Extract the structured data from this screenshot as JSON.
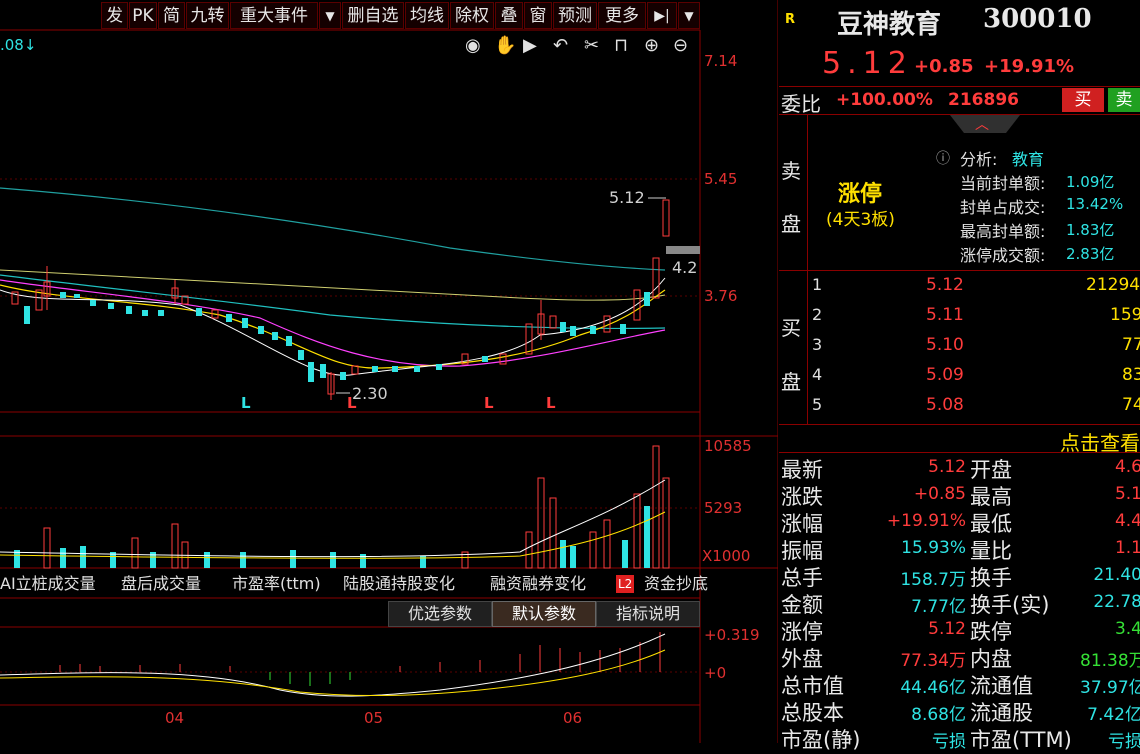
{
  "toolbar": {
    "items": [
      "发",
      "PK",
      "简",
      "九转",
      "重大事件",
      "▼",
      "删自选",
      "均线",
      "除权",
      "叠",
      "窗",
      "预测",
      "更多",
      "▶|",
      "▼"
    ],
    "corner_value": ".08↓"
  },
  "price_axis": [
    "7.14",
    "5.45",
    "3.76"
  ],
  "volume_axis": [
    "10585",
    "5293",
    "X1000"
  ],
  "macd_axis": [
    "+0.319",
    "+0"
  ],
  "date_labels": [
    "04",
    "05",
    "06"
  ],
  "annotations": {
    "high": "5.12",
    "low": "2.30",
    "right": "4.2",
    "L_marks": [
      "L",
      "L",
      "L",
      "L"
    ]
  },
  "tabs": [
    "AI立桩成交量",
    "盘后成交量",
    "市盈率(ttm)",
    "陆股通持股变化",
    "融资融券变化",
    "L2",
    "资金抄底"
  ],
  "param_buttons": [
    "优选参数",
    "默认参数",
    "指标说明"
  ],
  "stock": {
    "tag": "R",
    "name": "豆神教育",
    "code": "300010",
    "price": "5.12",
    "change": "+0.85",
    "change_pct": "+19.91%",
    "weibi_label": "委比",
    "weibi_pct": "+100.00%",
    "weibi_vol": "216896",
    "buy_btn": "买",
    "sell_btn": "卖"
  },
  "limit_panel": {
    "sell_label": [
      "卖",
      "盘"
    ],
    "status": "涨停",
    "status_sub": "(4天3板)",
    "analysis_label": "分析:",
    "analysis_value": "教育",
    "rows": [
      {
        "label": "当前封单额:",
        "value": "1.09亿"
      },
      {
        "label": "封单占成交:",
        "value": "13.42%"
      },
      {
        "label": "最高封单额:",
        "value": "1.83亿"
      },
      {
        "label": "涨停成交额:",
        "value": "2.83亿"
      }
    ]
  },
  "buy_book": {
    "label": [
      "买",
      "盘"
    ],
    "rows": [
      {
        "n": "1",
        "price": "5.12",
        "vol": "21294"
      },
      {
        "n": "2",
        "price": "5.11",
        "vol": "159"
      },
      {
        "n": "3",
        "price": "5.10",
        "vol": "77"
      },
      {
        "n": "4",
        "price": "5.09",
        "vol": "83"
      },
      {
        "n": "5",
        "price": "5.08",
        "vol": "74"
      }
    ]
  },
  "click_view": "点击查看",
  "quote": [
    {
      "l": "最新",
      "v": "5.12",
      "vc": "red",
      "l2": "开盘",
      "v2": "4.6",
      "vc2": "red"
    },
    {
      "l": "涨跌",
      "v": "+0.85",
      "vc": "red",
      "l2": "最高",
      "v2": "5.1",
      "vc2": "red"
    },
    {
      "l": "涨幅",
      "v": "+19.91%",
      "vc": "red",
      "l2": "最低",
      "v2": "4.4",
      "vc2": "red"
    },
    {
      "l": "振幅",
      "v": "15.93%",
      "vc": "cyan",
      "l2": "量比",
      "v2": "1.1",
      "vc2": "red"
    },
    {
      "l": "总手",
      "v": "158.7万",
      "vc": "cyan",
      "l2": "换手",
      "v2": "21.40",
      "vc2": "cyan"
    },
    {
      "l": "金额",
      "v": "7.77亿",
      "vc": "cyan",
      "l2": "换手(实)",
      "v2": "22.78",
      "vc2": "cyan"
    },
    {
      "l": "涨停",
      "v": "5.12",
      "vc": "red",
      "l2": "跌停",
      "v2": "3.4",
      "vc2": "green"
    },
    {
      "l": "外盘",
      "v": "77.34万",
      "vc": "red",
      "l2": "内盘",
      "v2": "81.38万",
      "vc2": "green"
    },
    {
      "l": "总市值",
      "v": "44.46亿",
      "vc": "cyan",
      "l2": "流通值",
      "v2": "37.97亿",
      "vc2": "cyan"
    },
    {
      "l": "总股本",
      "v": "8.68亿",
      "vc": "cyan",
      "l2": "流通股",
      "v2": "7.42亿",
      "vc2": "cyan"
    },
    {
      "l": "市盈(静)",
      "v": "亏损",
      "vc": "cyan",
      "l2": "市盈(TTM)",
      "v2": "亏损",
      "vc2": "cyan"
    }
  ],
  "colors": {
    "up": "#ff3c3c",
    "down": "#2fe3e3",
    "grid": "#8a0000",
    "ma5": "#ffffff",
    "ma10": "#ffe000",
    "ma20": "#ff40ff",
    "ma60": "#20c0c0"
  }
}
